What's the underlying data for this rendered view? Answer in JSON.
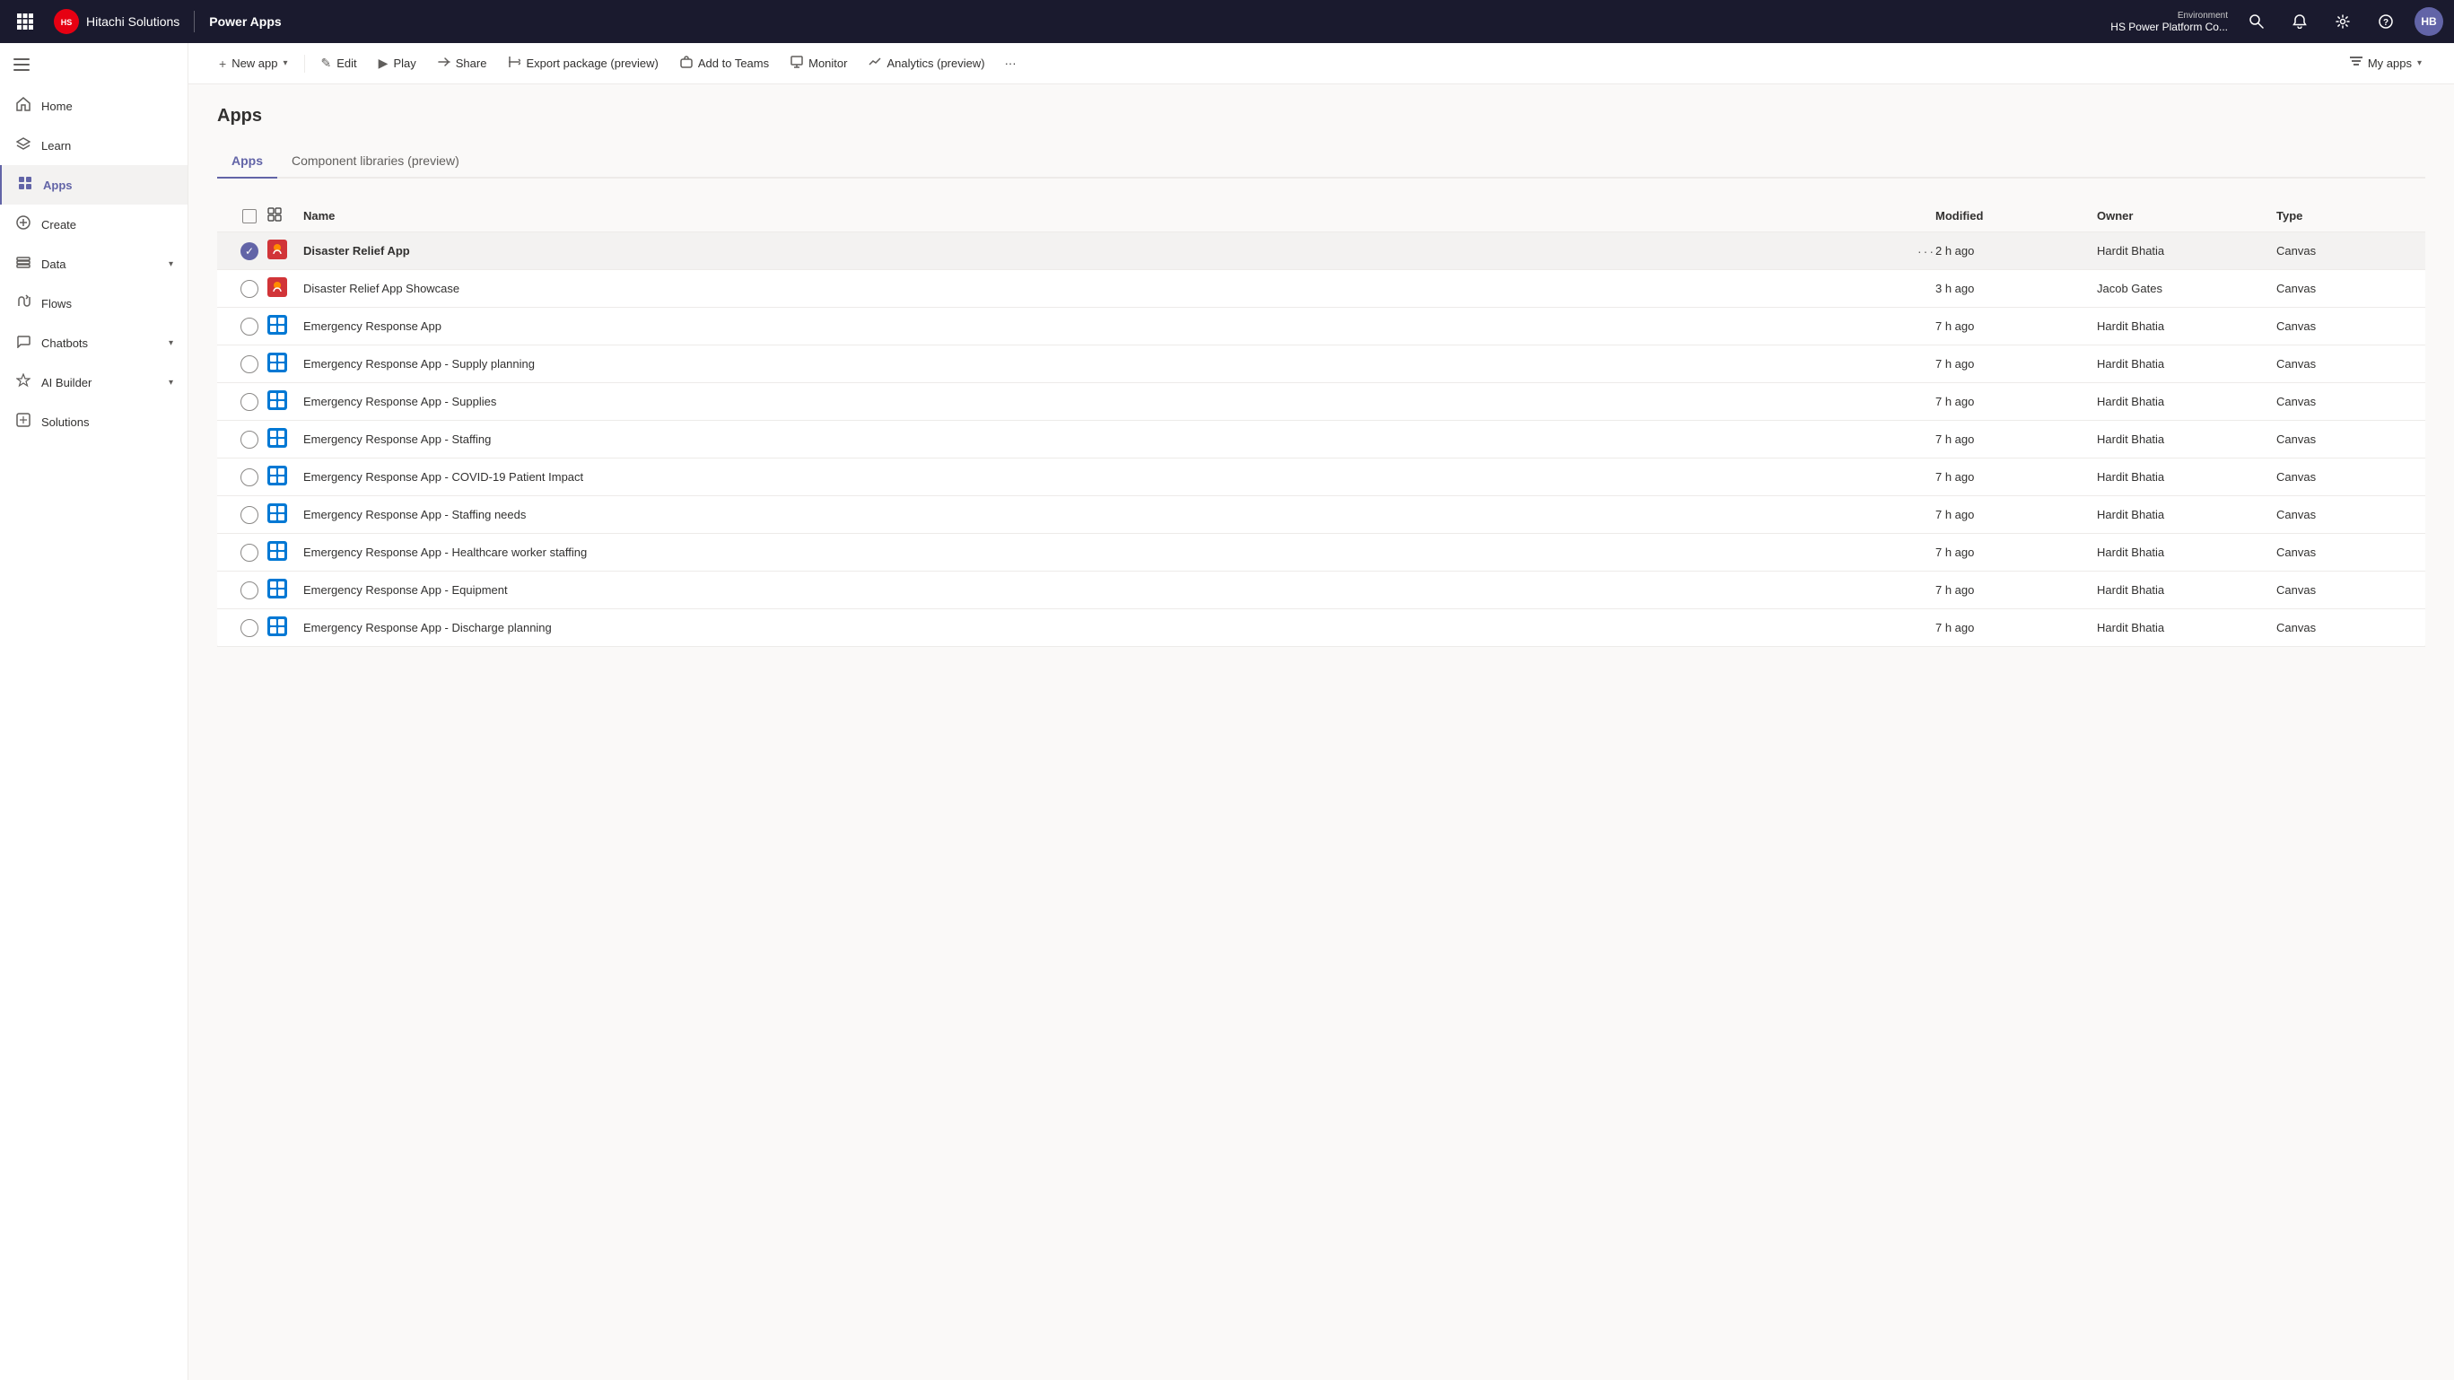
{
  "topbar": {
    "waffle_label": "⊞",
    "company_logo_initials": "HS",
    "company_name": "Hitachi Solutions",
    "app_name": "Power Apps",
    "environment_label": "Environment",
    "environment_name": "HS Power Platform Co...",
    "notification_icon": "🔔",
    "settings_icon": "⚙",
    "help_icon": "?",
    "avatar_initials": "HB"
  },
  "sidebar": {
    "toggle_icon": "☰",
    "items": [
      {
        "id": "home",
        "label": "Home",
        "icon": "⌂"
      },
      {
        "id": "learn",
        "label": "Learn",
        "icon": "🎓"
      },
      {
        "id": "apps",
        "label": "Apps",
        "icon": "⊞",
        "active": true
      },
      {
        "id": "create",
        "label": "Create",
        "icon": "+"
      },
      {
        "id": "data",
        "label": "Data",
        "icon": "▤",
        "has_chevron": true
      },
      {
        "id": "flows",
        "label": "Flows",
        "icon": "↻"
      },
      {
        "id": "chatbots",
        "label": "Chatbots",
        "icon": "💬",
        "has_chevron": true
      },
      {
        "id": "ai-builder",
        "label": "AI Builder",
        "icon": "✦",
        "has_chevron": true
      },
      {
        "id": "solutions",
        "label": "Solutions",
        "icon": "⧉"
      }
    ]
  },
  "toolbar": {
    "new_app_label": "New app",
    "edit_label": "Edit",
    "play_label": "Play",
    "share_label": "Share",
    "export_label": "Export package (preview)",
    "add_to_teams_label": "Add to Teams",
    "monitor_label": "Monitor",
    "analytics_label": "Analytics (preview)",
    "more_icon": "···",
    "my_apps_label": "My apps",
    "filter_icon": "≡"
  },
  "page": {
    "title": "Apps",
    "tabs": [
      {
        "id": "apps",
        "label": "Apps",
        "active": true
      },
      {
        "id": "component-libraries",
        "label": "Component libraries (preview)",
        "active": false
      }
    ]
  },
  "table": {
    "columns": [
      {
        "id": "checkbox",
        "label": ""
      },
      {
        "id": "icon",
        "label": ""
      },
      {
        "id": "name",
        "label": "Name"
      },
      {
        "id": "modified",
        "label": "Modified"
      },
      {
        "id": "owner",
        "label": "Owner"
      },
      {
        "id": "type",
        "label": "Type"
      }
    ],
    "rows": [
      {
        "id": 1,
        "name": "Disaster Relief App",
        "modified": "2 h ago",
        "owner": "Hardit Bhatia",
        "type": "Canvas",
        "selected": true,
        "icon_color": "orange",
        "icon_char": "🔥"
      },
      {
        "id": 2,
        "name": "Disaster Relief App Showcase",
        "modified": "3 h ago",
        "owner": "Jacob Gates",
        "type": "Canvas",
        "selected": false,
        "icon_color": "orange",
        "icon_char": "🔥"
      },
      {
        "id": 3,
        "name": "Emergency Response App",
        "modified": "7 h ago",
        "owner": "Hardit Bhatia",
        "type": "Canvas",
        "selected": false,
        "icon_color": "blue",
        "icon_char": "⊞"
      },
      {
        "id": 4,
        "name": "Emergency Response App - Supply planning",
        "modified": "7 h ago",
        "owner": "Hardit Bhatia",
        "type": "Canvas",
        "selected": false,
        "icon_color": "blue",
        "icon_char": "⊞"
      },
      {
        "id": 5,
        "name": "Emergency Response App - Supplies",
        "modified": "7 h ago",
        "owner": "Hardit Bhatia",
        "type": "Canvas",
        "selected": false,
        "icon_color": "blue",
        "icon_char": "⊞"
      },
      {
        "id": 6,
        "name": "Emergency Response App - Staffing",
        "modified": "7 h ago",
        "owner": "Hardit Bhatia",
        "type": "Canvas",
        "selected": false,
        "icon_color": "blue",
        "icon_char": "⊞"
      },
      {
        "id": 7,
        "name": "Emergency Response App - COVID-19 Patient Impact",
        "modified": "7 h ago",
        "owner": "Hardit Bhatia",
        "type": "Canvas",
        "selected": false,
        "icon_color": "blue",
        "icon_char": "⊞"
      },
      {
        "id": 8,
        "name": "Emergency Response App - Staffing needs",
        "modified": "7 h ago",
        "owner": "Hardit Bhatia",
        "type": "Canvas",
        "selected": false,
        "icon_color": "blue",
        "icon_char": "⊞"
      },
      {
        "id": 9,
        "name": "Emergency Response App - Healthcare worker staffing",
        "modified": "7 h ago",
        "owner": "Hardit Bhatia",
        "type": "Canvas",
        "selected": false,
        "icon_color": "blue",
        "icon_char": "⊞"
      },
      {
        "id": 10,
        "name": "Emergency Response App - Equipment",
        "modified": "7 h ago",
        "owner": "Hardit Bhatia",
        "type": "Canvas",
        "selected": false,
        "icon_color": "blue",
        "icon_char": "⊞"
      },
      {
        "id": 11,
        "name": "Emergency Response App - Discharge planning",
        "modified": "7 h ago",
        "owner": "Hardit Bhatia",
        "type": "Canvas",
        "selected": false,
        "icon_color": "blue",
        "icon_char": "⊞"
      }
    ]
  },
  "colors": {
    "primary": "#6264a7",
    "active_border": "#6264a7",
    "topbar_bg": "#1a1a2e",
    "hover_bg": "#f3f2f1"
  }
}
